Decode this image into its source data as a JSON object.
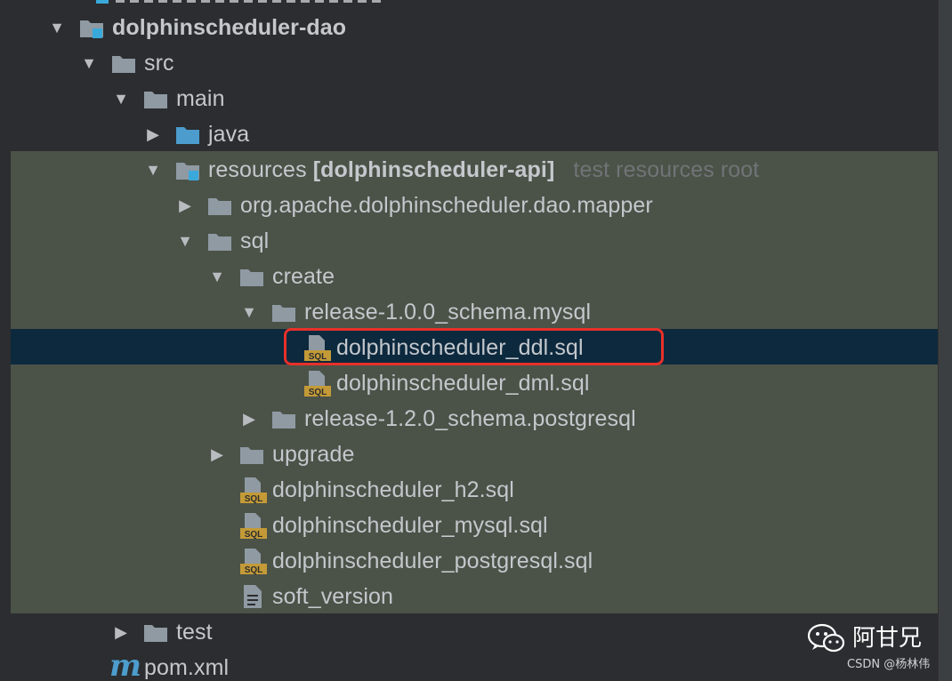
{
  "project_tree": {
    "rows": [
      {
        "label": "dolphinscheduler-dao",
        "icon": "module-folder-icon",
        "arrow": "expanded"
      },
      {
        "label": "src",
        "icon": "folder-icon",
        "arrow": "expanded"
      },
      {
        "label": "main",
        "icon": "folder-icon",
        "arrow": "expanded"
      },
      {
        "label": "java",
        "icon": "source-root-folder-icon",
        "arrow": "collapsed"
      },
      {
        "label": "resources",
        "suffix": "[dolphinscheduler-api]",
        "hint": "test resources root",
        "icon": "resources-root-folder-icon",
        "arrow": "expanded"
      },
      {
        "label": "org.apache.dolphinscheduler.dao.mapper",
        "icon": "folder-icon",
        "arrow": "collapsed"
      },
      {
        "label": "sql",
        "icon": "folder-icon",
        "arrow": "expanded"
      },
      {
        "label": "create",
        "icon": "folder-icon",
        "arrow": "expanded"
      },
      {
        "label": "release-1.0.0_schema.mysql",
        "icon": "folder-icon",
        "arrow": "expanded"
      },
      {
        "label": "dolphinscheduler_ddl.sql",
        "icon": "sql-file-icon",
        "selected": true
      },
      {
        "label": "dolphinscheduler_dml.sql",
        "icon": "sql-file-icon"
      },
      {
        "label": "release-1.2.0_schema.postgresql",
        "icon": "folder-icon",
        "arrow": "collapsed"
      },
      {
        "label": "upgrade",
        "icon": "folder-icon",
        "arrow": "collapsed"
      },
      {
        "label": "dolphinscheduler_h2.sql",
        "icon": "sql-file-icon"
      },
      {
        "label": "dolphinscheduler_mysql.sql",
        "icon": "sql-file-icon"
      },
      {
        "label": "dolphinscheduler_postgresql.sql",
        "icon": "sql-file-icon"
      },
      {
        "label": "soft_version",
        "icon": "text-file-icon"
      },
      {
        "label": "test",
        "icon": "folder-icon",
        "arrow": "collapsed"
      },
      {
        "label": "pom.xml",
        "icon": "maven-icon"
      }
    ]
  },
  "sql_badge": "SQL",
  "maven_glyph": "m",
  "watermark": {
    "icon": "wechat-icon",
    "text": "阿甘兄"
  },
  "credit": "CSDN @杨林伟",
  "colors": {
    "background": "#2b2d30",
    "resources_band": "#4b5248",
    "selection": "#0d293e",
    "highlight_box": "#e8302a",
    "folder": "#8f9aa3",
    "source_folder": "#4c9ccd",
    "sql_badge": "#c39a37"
  }
}
